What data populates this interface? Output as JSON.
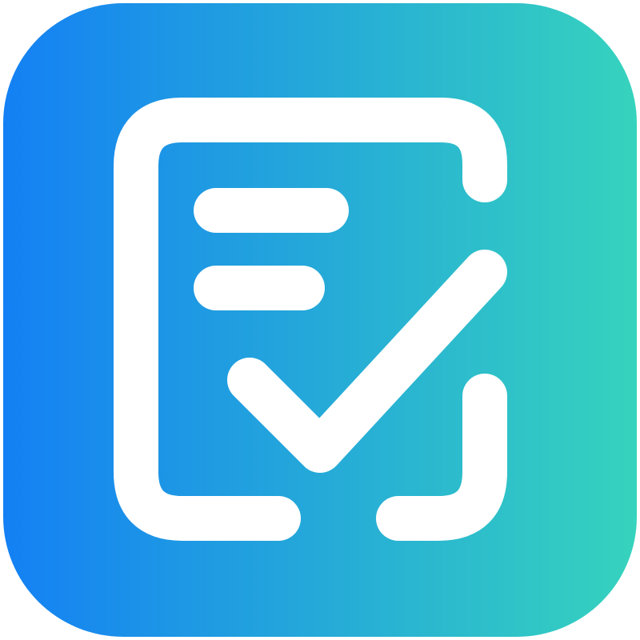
{
  "app_icon": {
    "icon": "checklist-document-icon",
    "colors": {
      "gradient_start": "#1480f4",
      "gradient_end": "#36d3bd",
      "glyph": "#ffffff"
    }
  }
}
